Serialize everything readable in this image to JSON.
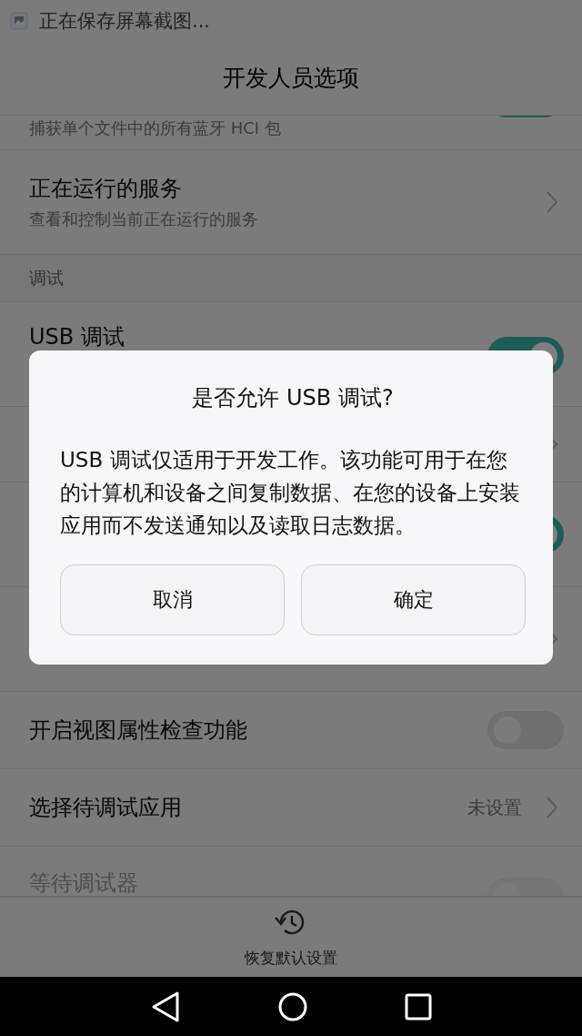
{
  "status_bar": {
    "notification": "正在保存屏幕截图..."
  },
  "title": "开发人员选项",
  "items": [
    {
      "kind": "toggle",
      "subtitle": "捕获单个文件中的所有蓝牙 HCI 包",
      "on": true,
      "disabled": false
    },
    {
      "kind": "link",
      "title": "正在运行的服务",
      "subtitle": "查看和控制当前正在运行的服务",
      "disabled": false
    },
    {
      "kind": "header",
      "title": "调试"
    },
    {
      "kind": "toggle",
      "title": "USB 调试",
      "on": true,
      "disabled": false
    },
    {
      "kind": "link"
    },
    {
      "kind": "toggle",
      "on": true,
      "disabled": false
    },
    {
      "kind": "link"
    },
    {
      "kind": "toggle",
      "title": "开启视图属性检查功能",
      "on": false,
      "disabled": false
    },
    {
      "kind": "link",
      "title": "选择待调试应用",
      "value": "未设置",
      "disabled": false
    },
    {
      "kind": "toggle",
      "title": "等待调试器",
      "on": false,
      "disabled": true
    }
  ],
  "bottom_action": {
    "label": "恢复默认设置"
  },
  "dialog": {
    "title": "是否允许 USB 调试?",
    "message": "USB 调试仅适用于开发工作。该功能可用于在您的计算机和设备之间复制数据、在您的设备上安装应用而不发送通知以及读取日志数据。",
    "buttons": [
      {
        "label": "取消"
      },
      {
        "label": "确定"
      }
    ]
  }
}
